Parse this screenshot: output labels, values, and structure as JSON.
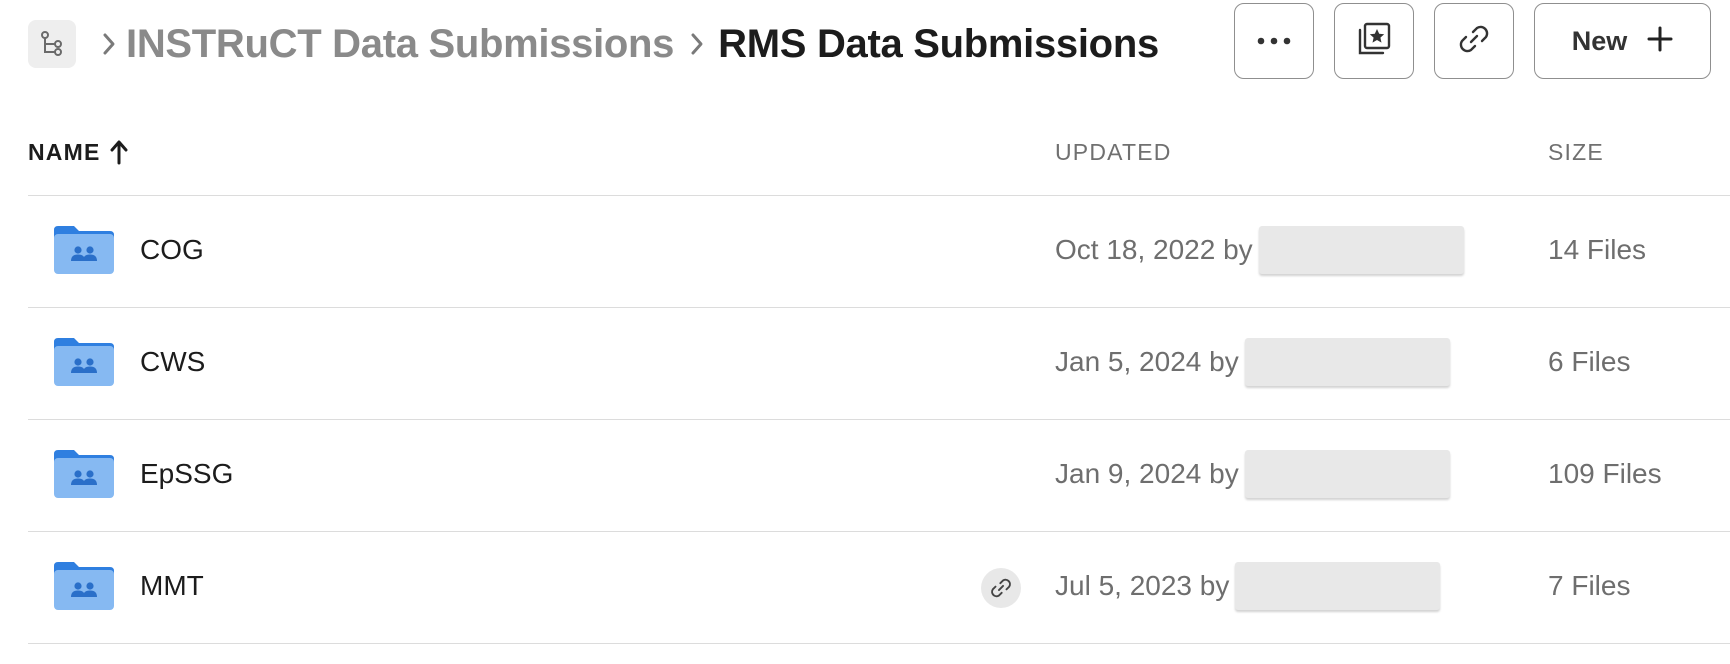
{
  "breadcrumb": {
    "parent": "INSTRuCT Data Submissions",
    "current": "RMS Data Submissions"
  },
  "actions": {
    "new_label": "New"
  },
  "columns": {
    "name": "NAME",
    "updated": "UPDATED",
    "size": "SIZE"
  },
  "rows": [
    {
      "name": "COG",
      "updated": "Oct 18, 2022 by",
      "size": "14 Files",
      "shared_link": false
    },
    {
      "name": "CWS",
      "updated": "Jan 5, 2024 by",
      "size": "6 Files",
      "shared_link": false
    },
    {
      "name": "EpSSG",
      "updated": "Jan 9, 2024 by",
      "size": "109 Files",
      "shared_link": false
    },
    {
      "name": "MMT",
      "updated": "Jul 5, 2023 by",
      "size": "7 Files",
      "shared_link": true
    }
  ],
  "colors": {
    "folder": "#4a90e2",
    "folder_light": "#7fb3f0",
    "text_primary": "#1c1c1c",
    "text_secondary": "#6e6e6e"
  },
  "icons": {
    "tree": "folder-tree-icon",
    "separator": "chevron-right-icon",
    "more": "more-options-icon",
    "favorites": "add-to-collection-icon",
    "link": "link-icon",
    "new": "plus-icon",
    "sort": "sort-ascending-arrow-icon",
    "folder": "shared-folder-icon"
  }
}
